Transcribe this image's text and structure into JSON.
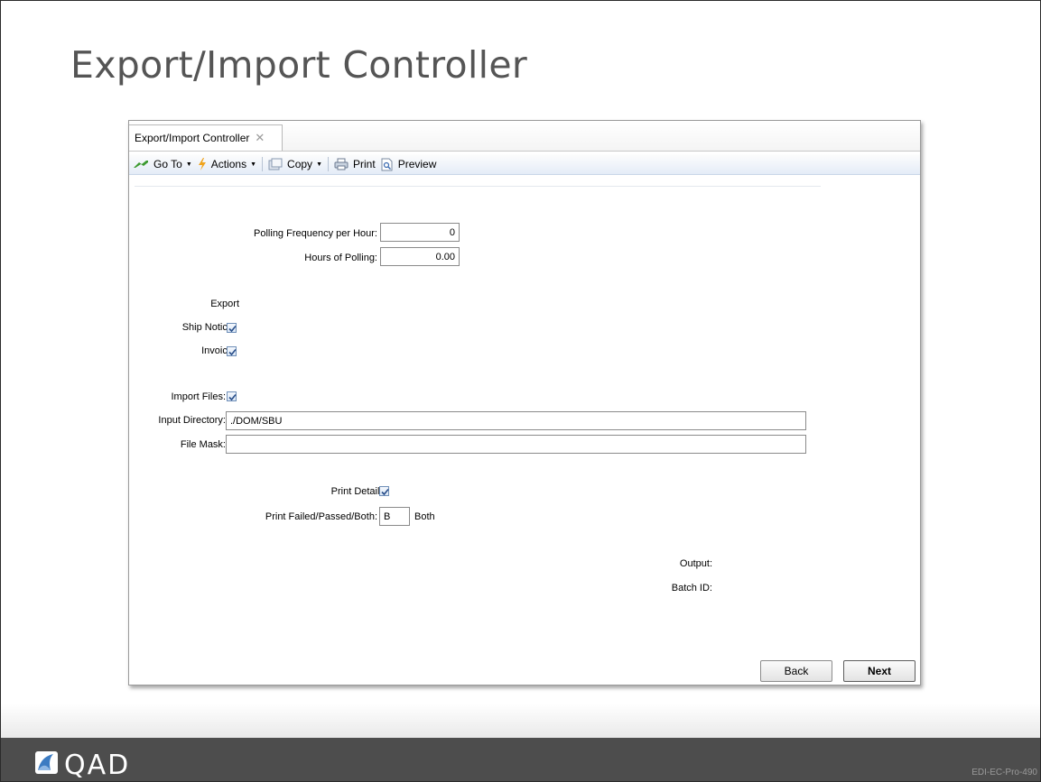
{
  "slide": {
    "title": "Export/Import Controller",
    "code": "EDI-EC-Pro-490",
    "logo_text": "QAD"
  },
  "window": {
    "tab_label": "Export/Import Controller",
    "tab_close": "✕",
    "toolbar": {
      "goto": "Go To",
      "actions": "Actions",
      "copy": "Copy",
      "print": "Print",
      "preview": "Preview"
    }
  },
  "form": {
    "polling_frequency": {
      "label": "Polling Frequency per Hour:",
      "value": "0"
    },
    "hours_of_polling": {
      "label": "Hours of Polling:",
      "value": "0.00"
    },
    "export_heading": "Export",
    "ship_notice": {
      "label": "Ship Notice:",
      "checked": true
    },
    "invoice": {
      "label": "Invoice:",
      "checked": true
    },
    "import_files": {
      "label": "Import Files:",
      "checked": true
    },
    "input_directory": {
      "label": "Input Directory:",
      "value": "./DOM/SBU"
    },
    "file_mask": {
      "label": "File Mask:",
      "value": ""
    },
    "print_details": {
      "label": "Print Details:",
      "checked": true
    },
    "print_failed_passed": {
      "label": "Print Failed/Passed/Both:",
      "value": "B",
      "description": "Both"
    },
    "output_label": "Output:",
    "batch_id_label": "Batch ID:"
  },
  "buttons": {
    "back": "Back",
    "next": "Next"
  },
  "colors": {
    "checkbox_border": "#6f8fb8",
    "check_mark": "#2a4f8a",
    "footer": "#4d4d4d",
    "title": "#555555"
  }
}
